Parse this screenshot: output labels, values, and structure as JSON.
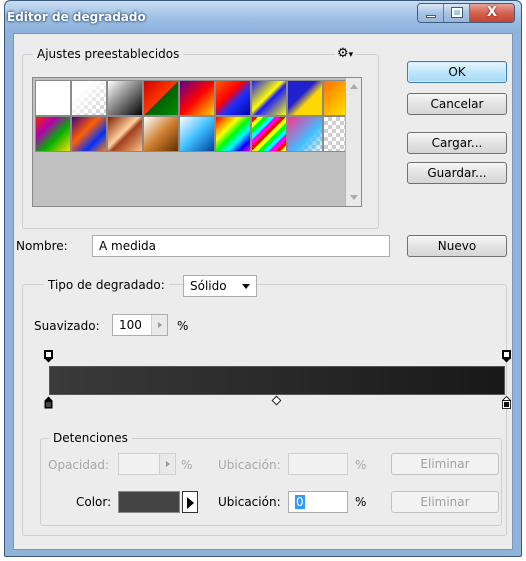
{
  "window": {
    "title": "Editor de degradado",
    "close_label": "X"
  },
  "presets": {
    "legend": "Ajustes preestablecidos",
    "menu_icon": "gear-icon",
    "swatches": [
      "linear-gradient(to right,#ffffff,#ffffff)",
      "linear-gradient(135deg,#fff 0%,#fff 30%,transparent 100%),repeating-conic-gradient(#ccc 0 25%,#fff 0 50%) 0 0/8px 8px",
      "linear-gradient(135deg,#fff,#000)",
      "linear-gradient(135deg,#d00000,#ff3a00 50%,#006000 51%,#009000)",
      "linear-gradient(135deg,#5a0090,#ff0000 50%,#ffd800)",
      "linear-gradient(135deg,#ff5a00,#ff0000 40%,#2030ff 60%,#0000a0)",
      "linear-gradient(135deg,#1a1aff,#ffff00 45%,#1a1aff 55%,#ffff00)",
      "linear-gradient(135deg,#2020d0 0%,#2020d0 40%,#ffd800 60%,#ffd800)",
      "linear-gradient(135deg,#ff7000,#ffff00)",
      "linear-gradient(135deg,#ff2000,#b000b0 30%,#00b000 60%,#ffe000)",
      "linear-gradient(135deg,#400080,#ff6000 40%,#0030ff 70%,#ff8000)",
      "linear-gradient(135deg,#802000,#ffd0a0 45%,#a04020 55%,#ffc080)",
      "linear-gradient(135deg,#ffffff,#d08030 50%,#603000)",
      "linear-gradient(135deg,#ffffff,#40c0ff 50%,#0040a0)",
      "linear-gradient(135deg,#ff0000,#ff8000,#ffff00,#00ff00,#00ffff,#0000ff,#ff00ff)",
      "repeating-linear-gradient(135deg,#ff0000 0 4px,#ffff00 4px 8px,#00ff00 8px 12px,#00ffff 12px 16px,#ff00ff 16px 20px)",
      "linear-gradient(135deg,#ff3090,#40c0ff 60%,transparent),repeating-conic-gradient(#ccc 0 25%,#fff 0 50%) 0 0/8px 8px",
      "repeating-conic-gradient(#cfcfcf 0 25%,#ffffff 0 50%) 0 0/8px 8px"
    ]
  },
  "buttons": {
    "ok": "OK",
    "cancel": "Cancelar",
    "load": "Cargar...",
    "save": "Guardar...",
    "new": "Nuevo"
  },
  "name_field": {
    "label": "Nombre:",
    "value": "A medida"
  },
  "gradient_type": {
    "label": "Tipo de degradado:",
    "value": "Sólido"
  },
  "smoothness": {
    "label": "Suavizado:",
    "value": "100",
    "unit": "%"
  },
  "stops": {
    "legend": "Detenciones",
    "opacity_label": "Opacidad:",
    "opacity_unit": "%",
    "opacity_location_label": "Ubicación:",
    "opacity_location_unit": "%",
    "delete_opacity": "Eliminar",
    "color_label": "Color:",
    "color_value": "#444444",
    "color_location_label": "Ubicación:",
    "color_location_value": "0",
    "color_location_unit": "%",
    "delete_color": "Eliminar"
  }
}
